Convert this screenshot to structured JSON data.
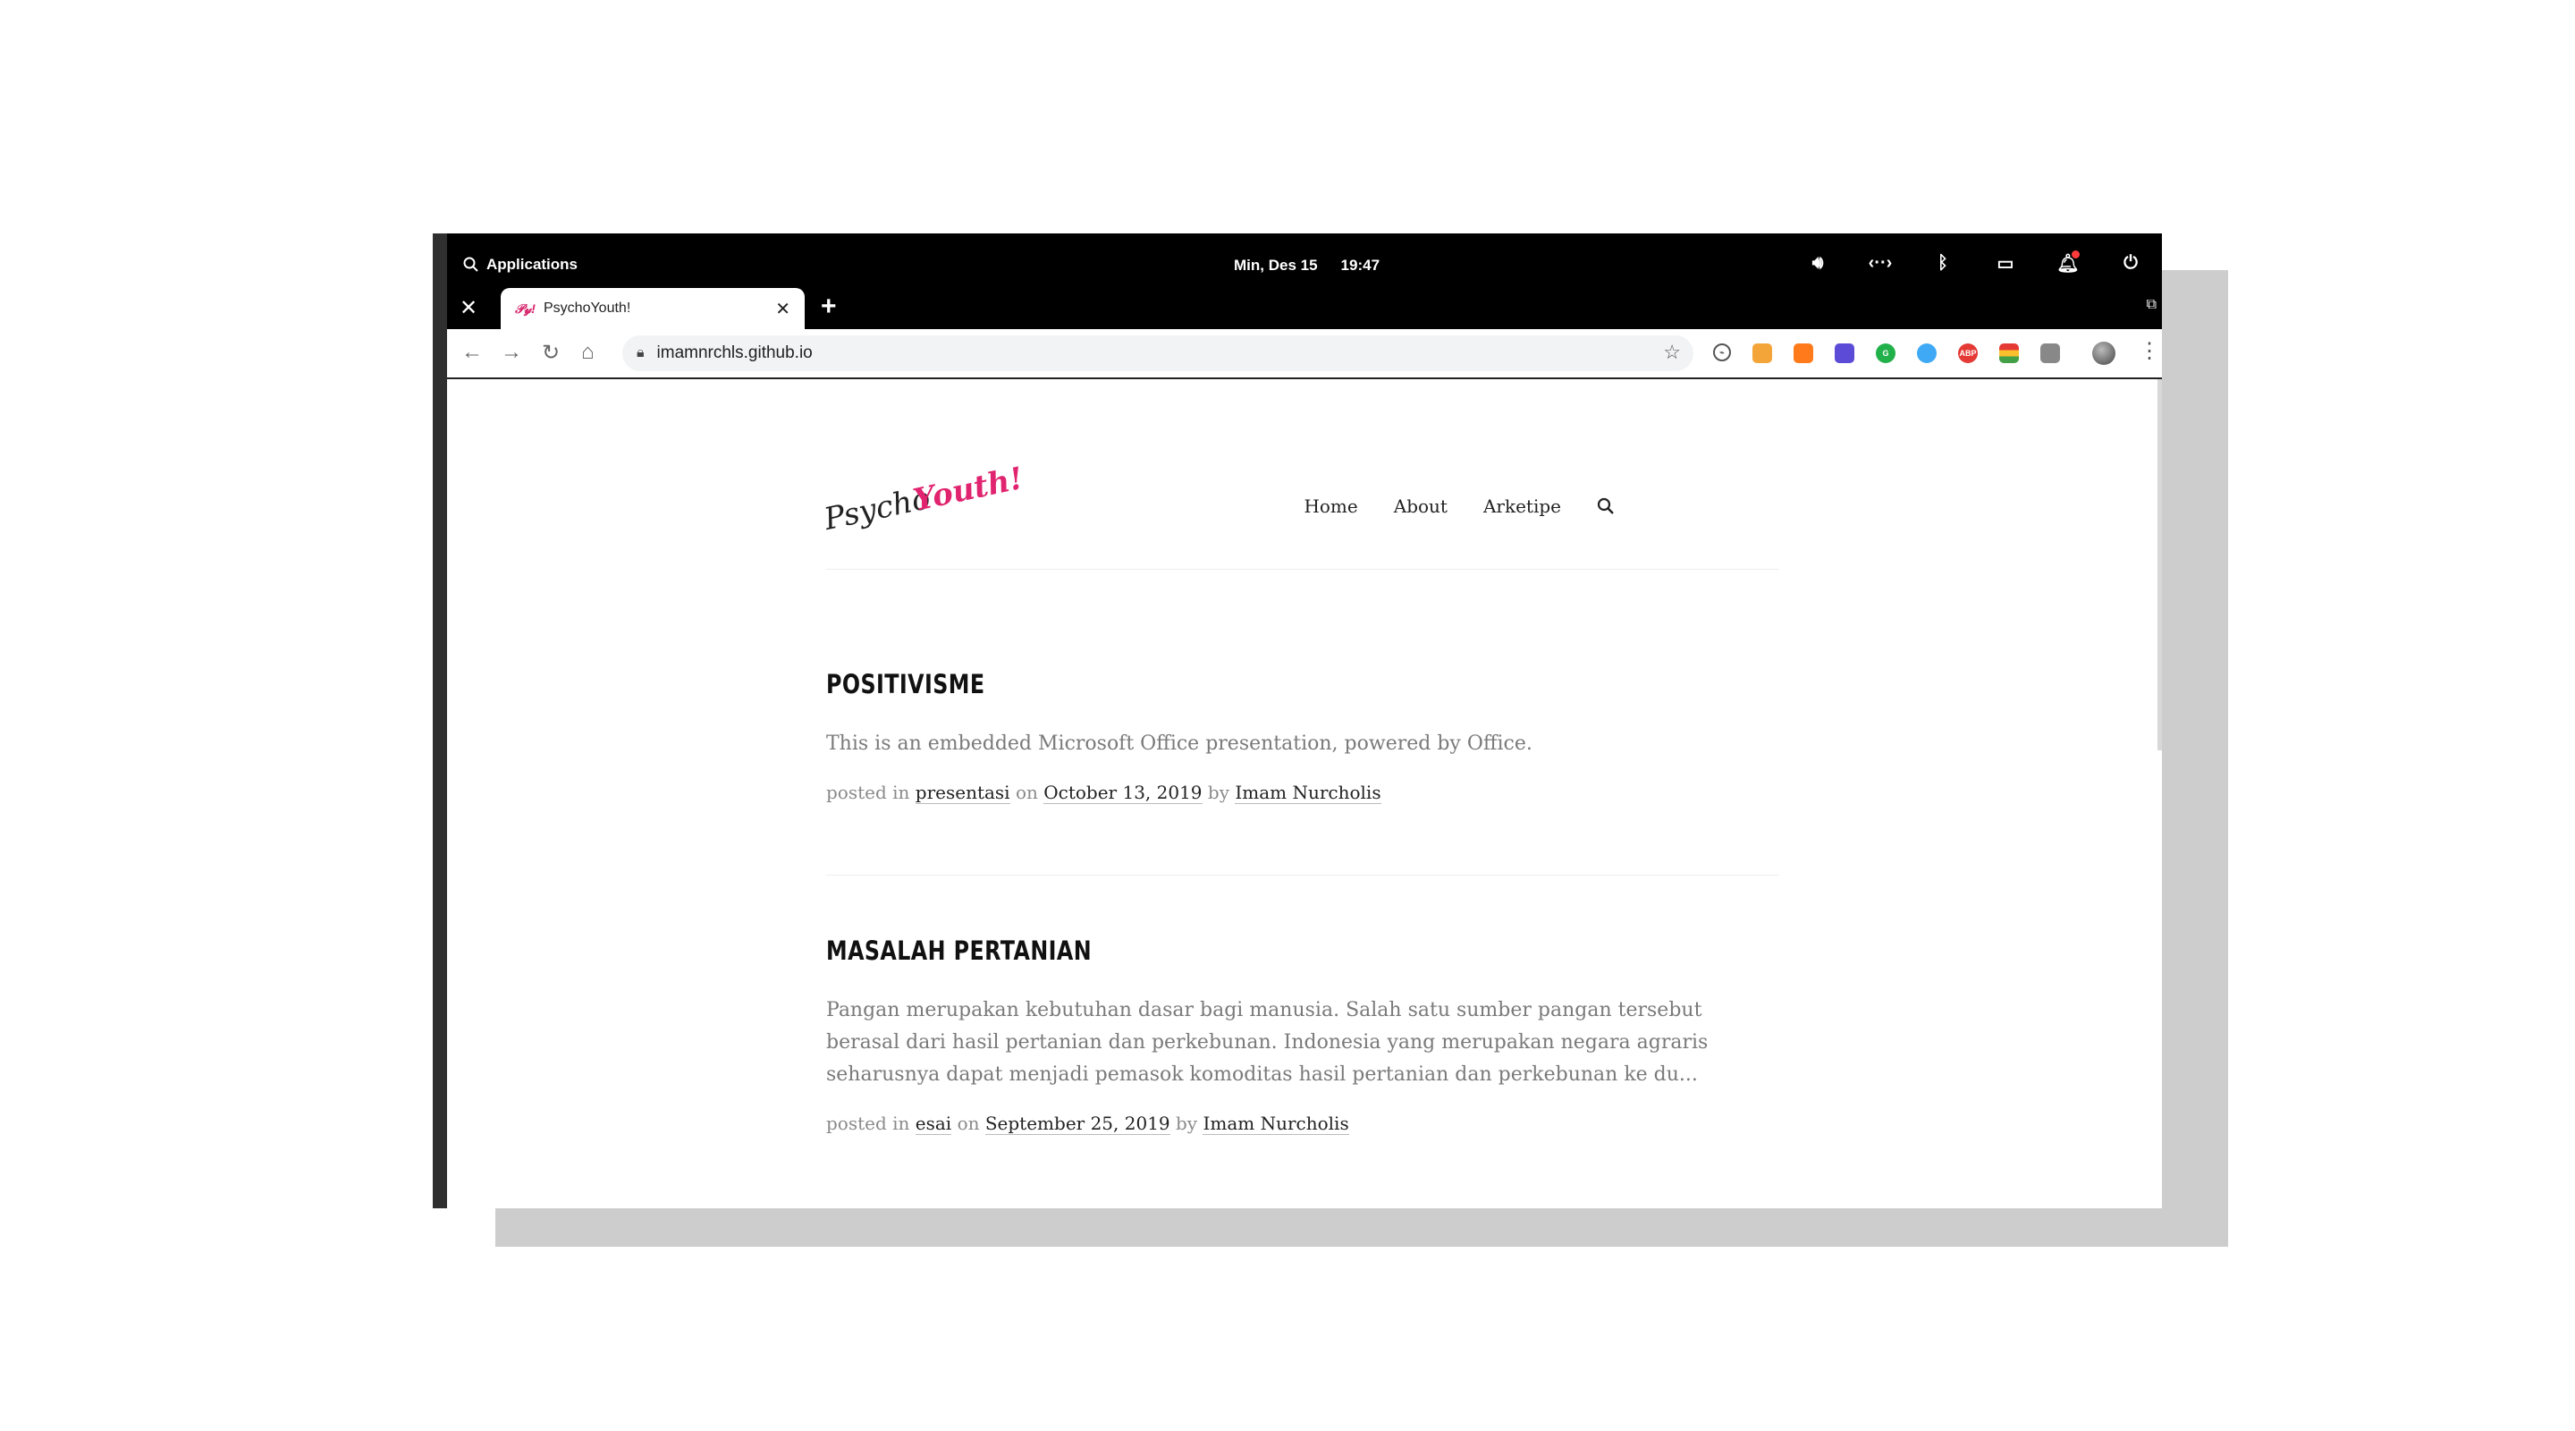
{
  "panel": {
    "applications_label": "Applications",
    "date": "Min, Des 15",
    "time": "19:47"
  },
  "tab": {
    "title": "PsychoYouth!",
    "favicon_text": "𝒫𝓎!"
  },
  "toolbar": {
    "url": "imamnrchls.github.io"
  },
  "site": {
    "logo_line1": "Psycho",
    "logo_line2": "Youth!",
    "nav": [
      "Home",
      "About",
      "Arketipe"
    ]
  },
  "posts": [
    {
      "title": "POSITIVISME",
      "excerpt": "This is an embedded Microsoft Office presentation, powered by Office.",
      "meta_prefix": "posted in",
      "category": "presentasi",
      "meta_on": "on",
      "date": "October 13, 2019",
      "meta_by": "by",
      "author": "Imam Nurcholis"
    },
    {
      "title": "MASALAH PERTANIAN",
      "excerpt": "Pangan merupakan kebutuhan dasar bagi manusia. Salah satu sumber pangan tersebut berasal dari hasil pertanian dan perkebunan. Indonesia yang merupakan negara agraris seharusnya dapat menjadi pemasok komoditas hasil pertanian dan perkebunan ke du...",
      "meta_prefix": "posted in",
      "category": "esai",
      "meta_on": "on",
      "date": "September 25, 2019",
      "meta_by": "by",
      "author": "Imam Nurcholis"
    }
  ],
  "colors": {
    "accent_pink": "#e0246f",
    "frame": "#000000"
  }
}
